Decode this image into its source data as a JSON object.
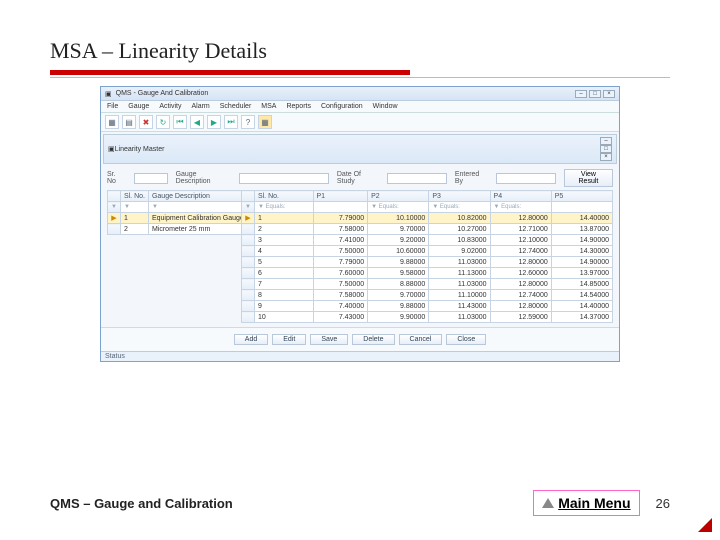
{
  "slide": {
    "title": "MSA – Linearity Details",
    "footer": "QMS – Gauge and Calibration",
    "mainmenu": "Main Menu",
    "page": "26"
  },
  "app": {
    "title": "QMS - Gauge And Calibration",
    "menu": [
      "File",
      "Gauge",
      "Activity",
      "Alarm",
      "Scheduler",
      "MSA",
      "Reports",
      "Configuration",
      "Window"
    ],
    "subwindow": "Linearity Master",
    "labels": {
      "srno": "Sr. No",
      "desc": "Gauge Description",
      "date": "Date Of Study",
      "by": "Entered By"
    },
    "viewbtn": "View Result"
  },
  "leftcols": [
    "",
    "Sl. No.",
    "Gauge Description"
  ],
  "leftrows": [
    {
      "n": "1",
      "desc": "Equipment Calibration Gauge",
      "sel": true
    },
    {
      "n": "2",
      "desc": "Micrometer 25 mm",
      "sel": false
    }
  ],
  "rightcols": [
    "",
    "Sl. No.",
    "P1",
    "P2",
    "P3",
    "P4",
    "P5"
  ],
  "filters": [
    "▼",
    "▼ Equals:",
    "",
    "▼ Equals:",
    "▼ Equals:",
    "▼ Equals:",
    ""
  ],
  "rows": [
    {
      "n": "1",
      "p1": "7.79000",
      "p2": "10.10000",
      "p3": "10.82000",
      "p4": "12.80000",
      "p5": "14.40000",
      "sel": true
    },
    {
      "n": "2",
      "p1": "7.58000",
      "p2": "9.70000",
      "p3": "10.27000",
      "p4": "12.71000",
      "p5": "13.87000"
    },
    {
      "n": "3",
      "p1": "7.41000",
      "p2": "9.20000",
      "p3": "10.83000",
      "p4": "12.10000",
      "p5": "14.90000"
    },
    {
      "n": "4",
      "p1": "7.50000",
      "p2": "10.60000",
      "p3": "9.02000",
      "p4": "12.74000",
      "p5": "14.30000"
    },
    {
      "n": "5",
      "p1": "7.79000",
      "p2": "9.88000",
      "p3": "11.03000",
      "p4": "12.80000",
      "p5": "14.90000"
    },
    {
      "n": "6",
      "p1": "7.60000",
      "p2": "9.58000",
      "p3": "11.13000",
      "p4": "12.60000",
      "p5": "13.97000"
    },
    {
      "n": "7",
      "p1": "7.50000",
      "p2": "8.88000",
      "p3": "11.03000",
      "p4": "12.80000",
      "p5": "14.85000"
    },
    {
      "n": "8",
      "p1": "7.58000",
      "p2": "9.70000",
      "p3": "11.10000",
      "p4": "12.74000",
      "p5": "14.54000"
    },
    {
      "n": "9",
      "p1": "7.40000",
      "p2": "9.88000",
      "p3": "11.43000",
      "p4": "12.80000",
      "p5": "14.40000"
    },
    {
      "n": "10",
      "p1": "7.43000",
      "p2": "9.90000",
      "p3": "11.03000",
      "p4": "12.59000",
      "p5": "14.37000"
    }
  ],
  "buttons": [
    "Add",
    "Edit",
    "Save",
    "Delete",
    "Cancel",
    "Close"
  ],
  "status": "Status"
}
